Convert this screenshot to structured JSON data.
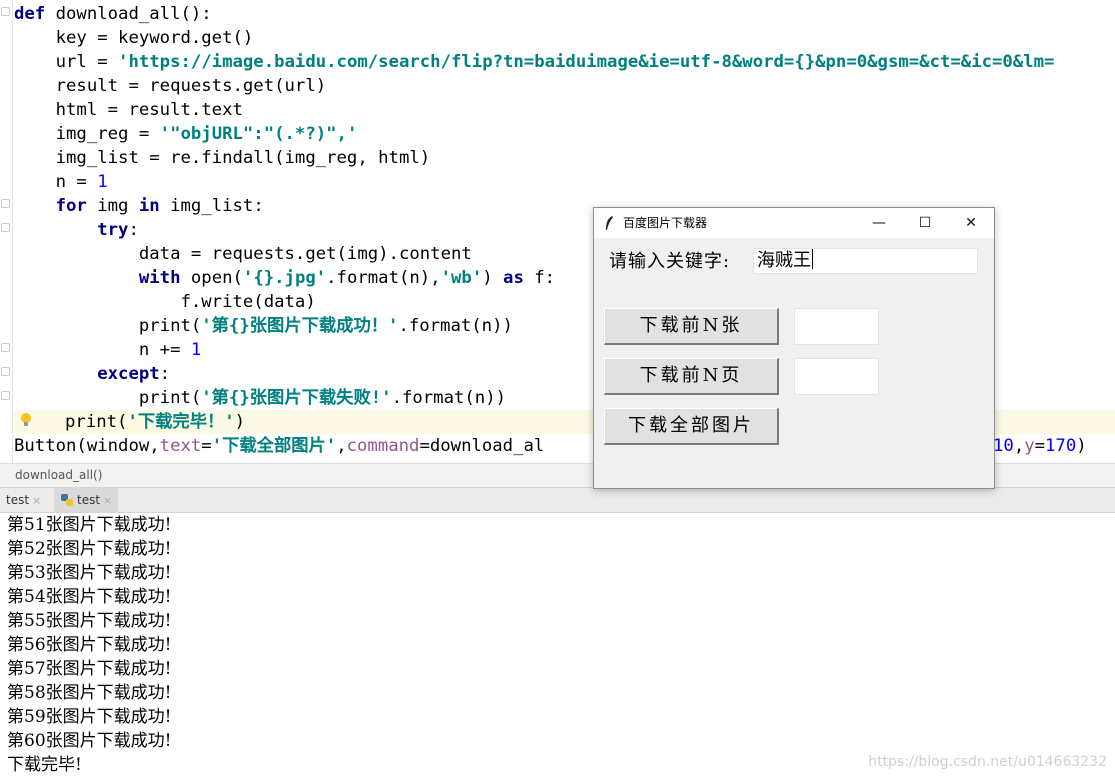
{
  "editor": {
    "line_height": 24,
    "lines": [
      "def download_all():",
      "    key = keyword.get()",
      "    url = 'https://image.baidu.com/search/flip?tn=baiduimage&ie=utf-8&word={}&pn=0&gsm=&ct=&ic=0&lm=",
      "    result = requests.get(url)",
      "    html = result.text",
      "    img_reg = '\"objURL\":\"(.*?)\",'",
      "    img_list = re.findall(img_reg, html)",
      "    n = 1",
      "    for img in img_list:",
      "        try:",
      "            data = requests.get(img).content",
      "            with open('{}.jpg'.format(n),'wb') as f:",
      "                f.write(data)",
      "            print('第{}张图片下载成功！'.format(n))",
      "            n += 1",
      "        except:",
      "            print('第{}张图片下载失败!'.format(n))",
      "    print('下载完毕！')",
      "Button(window,text='下载全部图片',command=download_al",
      "10,y=170)"
    ]
  },
  "breadcrumb": "download_all()",
  "run_tabs": [
    {
      "label": "test",
      "close": "×"
    },
    {
      "label": "test",
      "close": "×"
    }
  ],
  "console": {
    "lines": [
      "第51张图片下载成功!",
      "第52张图片下载成功!",
      "第53张图片下载成功!",
      "第54张图片下载成功!",
      "第55张图片下载成功!",
      "第56张图片下载成功!",
      "第57张图片下载成功!",
      "第58张图片下载成功!",
      "第59张图片下载成功!",
      "第60张图片下载成功!",
      "下载完毕!"
    ]
  },
  "watermark": "https://blog.csdn.net/u014663232",
  "tk_window": {
    "title": "百度图片下载器",
    "minimize": "—",
    "maximize": "☐",
    "close": "✕",
    "keyword_label": "请输入关键字:",
    "keyword_value": "海贼王",
    "btn_first_n": "下载前N张",
    "btn_first_n_pages": "下载前N页",
    "btn_all": "下载全部图片",
    "count_value": "",
    "pages_value": ""
  }
}
